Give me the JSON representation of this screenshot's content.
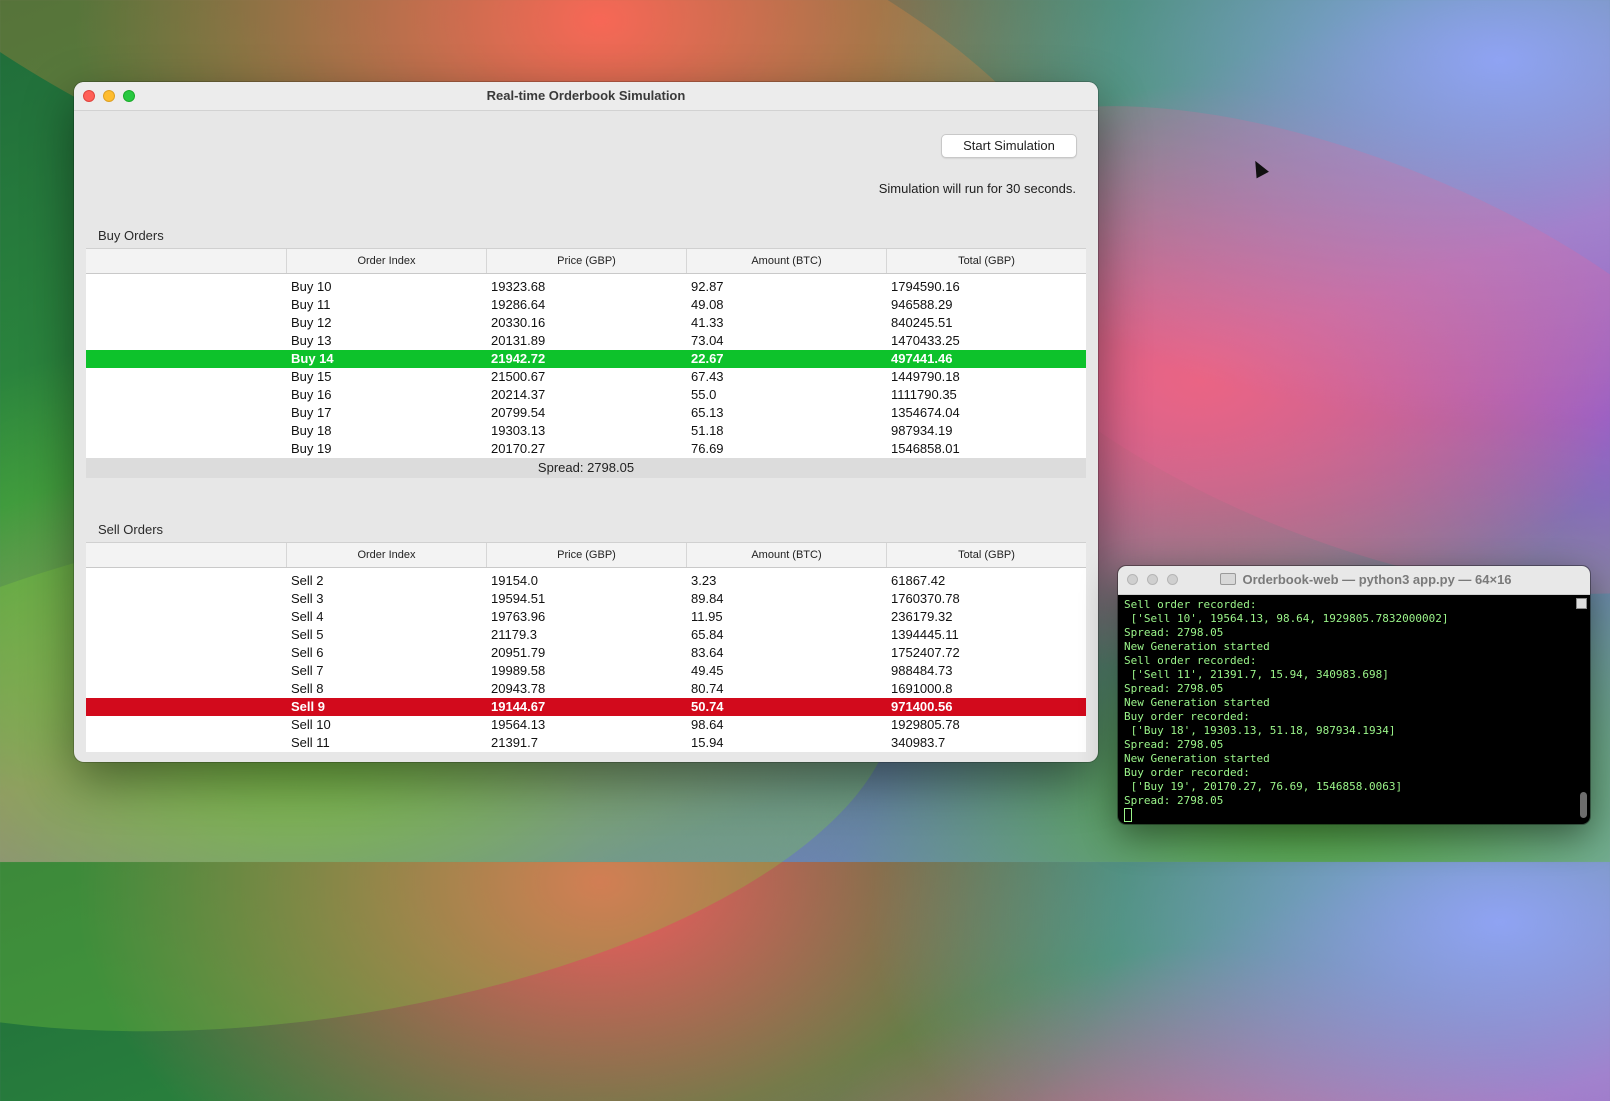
{
  "window": {
    "title": "Real-time Orderbook Simulation",
    "start_button": "Start Simulation",
    "sim_note": "Simulation will run for 30 seconds."
  },
  "buy": {
    "label": "Buy Orders",
    "columns": [
      "",
      "Order Index",
      "Price (GBP)",
      "Amount (BTC)",
      "Total (GBP)"
    ],
    "rows": [
      [
        "Buy 10",
        "19323.68",
        "92.87",
        "1794590.16"
      ],
      [
        "Buy 11",
        "19286.64",
        "49.08",
        "946588.29"
      ],
      [
        "Buy 12",
        "20330.16",
        "41.33",
        "840245.51"
      ],
      [
        "Buy 13",
        "20131.89",
        "73.04",
        "1470433.25"
      ],
      [
        "Buy 14",
        "21942.72",
        "22.67",
        "497441.46"
      ],
      [
        "Buy 15",
        "21500.67",
        "67.43",
        "1449790.18"
      ],
      [
        "Buy 16",
        "20214.37",
        "55.0",
        "1111790.35"
      ],
      [
        "Buy 17",
        "20799.54",
        "65.13",
        "1354674.04"
      ],
      [
        "Buy 18",
        "19303.13",
        "51.18",
        "987934.19"
      ],
      [
        "Buy 19",
        "20170.27",
        "76.69",
        "1546858.01"
      ]
    ],
    "highlight_color": "#0dc22b"
  },
  "spread": "Spread: 2798.05",
  "sell": {
    "label": "Sell Orders",
    "columns": [
      "",
      "Order Index",
      "Price (GBP)",
      "Amount (BTC)",
      "Total (GBP)"
    ],
    "rows": [
      [
        "Sell 2",
        "19154.0",
        "3.23",
        "61867.42"
      ],
      [
        "Sell 3",
        "19594.51",
        "89.84",
        "1760370.78"
      ],
      [
        "Sell 4",
        "19763.96",
        "11.95",
        "236179.32"
      ],
      [
        "Sell 5",
        "21179.3",
        "65.84",
        "1394445.11"
      ],
      [
        "Sell 6",
        "20951.79",
        "83.64",
        "1752407.72"
      ],
      [
        "Sell 7",
        "19989.58",
        "49.45",
        "988484.73"
      ],
      [
        "Sell 8",
        "20943.78",
        "80.74",
        "1691000.8"
      ],
      [
        "Sell 9",
        "19144.67",
        "50.74",
        "971400.56"
      ],
      [
        "Sell 10",
        "19564.13",
        "98.64",
        "1929805.78"
      ],
      [
        "Sell 11",
        "21391.7",
        "15.94",
        "340983.7"
      ]
    ],
    "highlight_color": "#d20a1c"
  },
  "terminal": {
    "title": "Orderbook-web — python3 app.py — 64×16",
    "lines": [
      "Sell order recorded:",
      " ['Sell 10', 19564.13, 98.64, 1929805.7832000002]",
      "Spread: 2798.05",
      "New Generation started",
      "Sell order recorded:",
      " ['Sell 11', 21391.7, 15.94, 340983.698]",
      "Spread: 2798.05",
      "New Generation started",
      "Buy order recorded:",
      " ['Buy 18', 19303.13, 51.18, 987934.1934]",
      "Spread: 2798.05",
      "New Generation started",
      "Buy order recorded:",
      " ['Buy 19', 20170.27, 76.69, 1546858.0063]",
      "Spread: 2798.05"
    ],
    "text_color": "#9bf58a"
  }
}
